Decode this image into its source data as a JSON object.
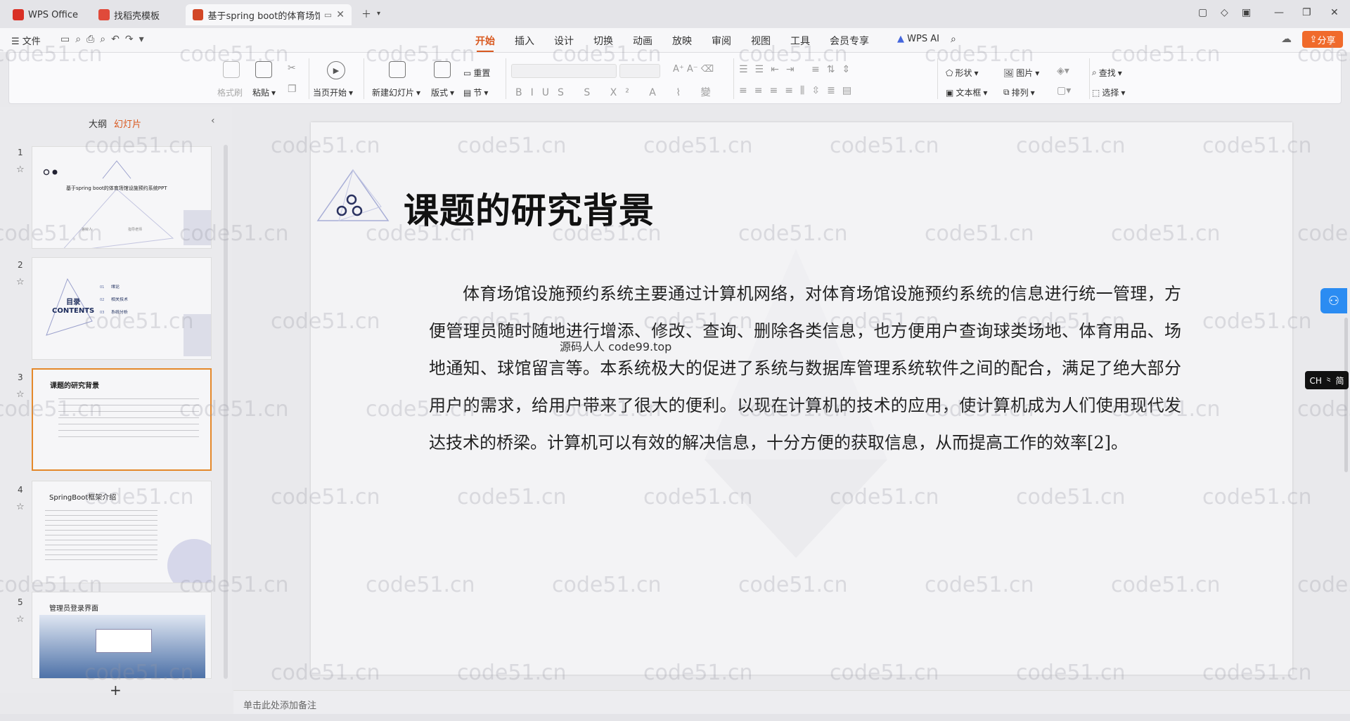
{
  "tabs": [
    {
      "label": "WPS Office",
      "color": "#d93025"
    },
    {
      "label": "找稻壳模板",
      "color": "#e04a3a"
    },
    {
      "label": "基于spring boot的体育场馆",
      "color": "#d24726"
    }
  ],
  "menu": {
    "file": "文件",
    "tabs": [
      "开始",
      "插入",
      "设计",
      "切换",
      "动画",
      "放映",
      "审阅",
      "视图",
      "工具",
      "会员专享"
    ],
    "wps_ai": "WPS AI",
    "share": "分享"
  },
  "ribbon": {
    "format_painter": "格式刷",
    "paste": "粘贴",
    "play_from_current": "当页开始",
    "new_slide": "新建幻灯片",
    "layout": "版式",
    "section": "节",
    "reset": "重置",
    "shape": "形状",
    "picture": "图片",
    "textbox": "文本框",
    "arrange": "排列",
    "find": "查找",
    "select": "选择"
  },
  "panel": {
    "outline_tab": "大纲",
    "slides_tab": "幻灯片",
    "add": "+"
  },
  "thumbnails": [
    {
      "num": "1",
      "title": "基于spring boot的体育场馆设施预约系统PPT",
      "sub1": "答辩人",
      "sub2": "指导老师"
    },
    {
      "num": "2",
      "title": "目录\nCONTENTS",
      "items": [
        "绪论",
        "相关技术",
        "系统分析"
      ],
      "item_nums": [
        "01",
        "02",
        "03"
      ]
    },
    {
      "num": "3",
      "title": "课题的研究背景"
    },
    {
      "num": "4",
      "title": "SpringBoot框架介绍"
    },
    {
      "num": "5",
      "title": "管理员登录界面"
    }
  ],
  "slide": {
    "title": "课题的研究背景",
    "body": "体育场馆设施预约系统主要通过计算机网络，对体育场馆设施预约系统的信息进行统一管理，方便管理员随时随地进行增添、修改、查询、删除各类信息，也方便用户查询球类场地、体育用品、场地通知、球馆留言等。本系统极大的促进了系统与数据库管理系统软件之间的配合，满足了绝大部分用户的需求，给用户带来了很大的便利。以现在计算机的技术的应用，使计算机成为人们使用现代发达技术的桥梁。计算机可以有效的解决信息，十分方便的获取信息，从而提高工作的效率[2]。",
    "overlay": "源码人人  code99.top"
  },
  "notes_placeholder": "单击此处添加备注",
  "ime": "CH ⺀ 简",
  "watermark": "code51.cn"
}
